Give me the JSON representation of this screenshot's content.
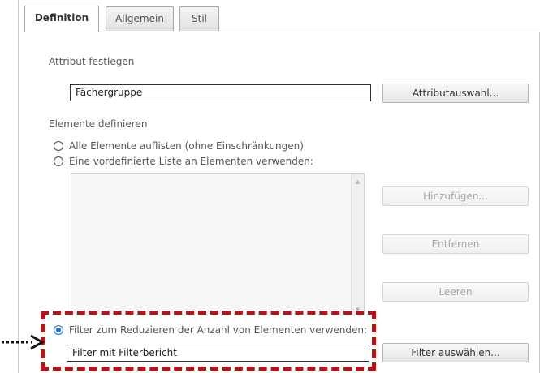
{
  "tabs": [
    {
      "label": "Definition",
      "active": true
    },
    {
      "label": "Allgemein",
      "active": false
    },
    {
      "label": "Stil",
      "active": false
    }
  ],
  "attribute": {
    "section_label": "Attribut festlegen",
    "value": "Fächergruppe",
    "select_button": "Attributauswahl..."
  },
  "elements": {
    "section_label": "Elemente definieren",
    "options": [
      {
        "label": "Alle Elemente auflisten (ohne Einschränkungen)",
        "checked": false
      },
      {
        "label": "Eine vordefinierte Liste an Elementen verwenden:",
        "checked": false
      }
    ],
    "list_buttons": {
      "add": "Hinzufügen...",
      "remove": "Entfernen",
      "clear": "Leeren"
    }
  },
  "filter": {
    "option_label": "Filter zum Reduzieren der Anzahl von Elementen verwenden:",
    "checked": true,
    "value": "Filter mit Filterbericht",
    "select_button": "Filter auswählen..."
  },
  "colors": {
    "highlight": "#b4141a",
    "radio_checked": "#1a6fd6",
    "arrow": "#111111"
  }
}
